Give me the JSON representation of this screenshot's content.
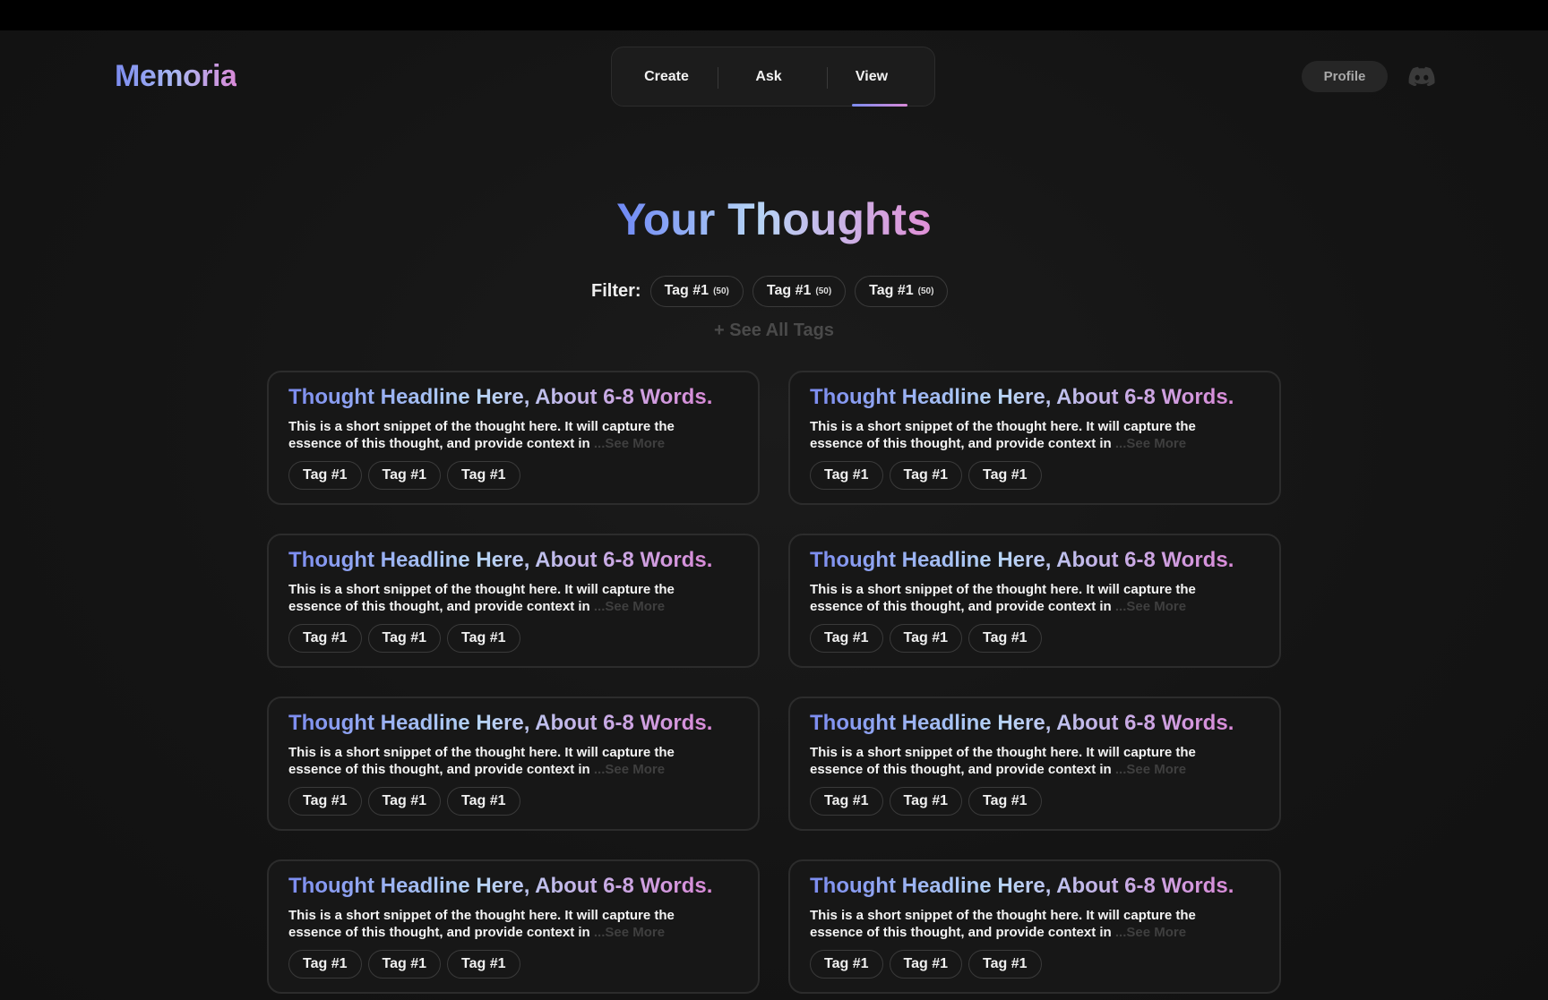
{
  "app": {
    "logo": "Memoria"
  },
  "nav": {
    "items": [
      "Create",
      "Ask",
      "View"
    ],
    "active": "View"
  },
  "header": {
    "profile_label": "Profile",
    "discord_icon": "discord-icon"
  },
  "page": {
    "title": "Your Thoughts",
    "filter_label": "Filter:",
    "filter_chips": [
      {
        "label": "Tag #1",
        "count": "(50)"
      },
      {
        "label": "Tag #1",
        "count": "(50)"
      },
      {
        "label": "Tag #1",
        "count": "(50)"
      }
    ],
    "see_all_tags": "+ See All Tags"
  },
  "cards": [
    {
      "title": "Thought Headline Here, About 6-8 Words.",
      "snippet": "This is a short snippet of the thought here. It will capture the essence of this thought, and provide context in",
      "see_more": "...See More",
      "tags": [
        "Tag #1",
        "Tag #1",
        "Tag #1"
      ]
    },
    {
      "title": "Thought Headline Here, About 6-8 Words.",
      "snippet": "This is a short snippet of the thought here. It will capture the essence of this thought, and provide context in",
      "see_more": "...See More",
      "tags": [
        "Tag #1",
        "Tag #1",
        "Tag #1"
      ]
    },
    {
      "title": "Thought Headline Here, About 6-8 Words.",
      "snippet": "This is a short snippet of the thought here. It will capture the essence of this thought, and provide context in",
      "see_more": "...See More",
      "tags": [
        "Tag #1",
        "Tag #1",
        "Tag #1"
      ]
    },
    {
      "title": "Thought Headline Here, About 6-8 Words.",
      "snippet": "This is a short snippet of the thought here. It will capture the essence of this thought, and provide context in",
      "see_more": "...See More",
      "tags": [
        "Tag #1",
        "Tag #1",
        "Tag #1"
      ]
    },
    {
      "title": "Thought Headline Here, About 6-8 Words.",
      "snippet": "This is a short snippet of the thought here. It will capture the essence of this thought, and provide context in",
      "see_more": "...See More",
      "tags": [
        "Tag #1",
        "Tag #1",
        "Tag #1"
      ]
    },
    {
      "title": "Thought Headline Here, About 6-8 Words.",
      "snippet": "This is a short snippet of the thought here. It will capture the essence of this thought, and provide context in",
      "see_more": "...See More",
      "tags": [
        "Tag #1",
        "Tag #1",
        "Tag #1"
      ]
    },
    {
      "title": "Thought Headline Here, About 6-8 Words.",
      "snippet": "This is a short snippet of the thought here. It will capture the essence of this thought, and provide context in",
      "see_more": "...See More",
      "tags": [
        "Tag #1",
        "Tag #1",
        "Tag #1"
      ]
    },
    {
      "title": "Thought Headline Here, About 6-8 Words.",
      "snippet": "This is a short snippet of the thought here. It will capture the essence of this thought, and provide context in",
      "see_more": "...See More",
      "tags": [
        "Tag #1",
        "Tag #1",
        "Tag #1"
      ]
    }
  ],
  "colors": {
    "background": "#141414",
    "accent_start": "#7c8cf0",
    "accent_mid": "#b6d4f5",
    "accent_end": "#d98ad8"
  }
}
